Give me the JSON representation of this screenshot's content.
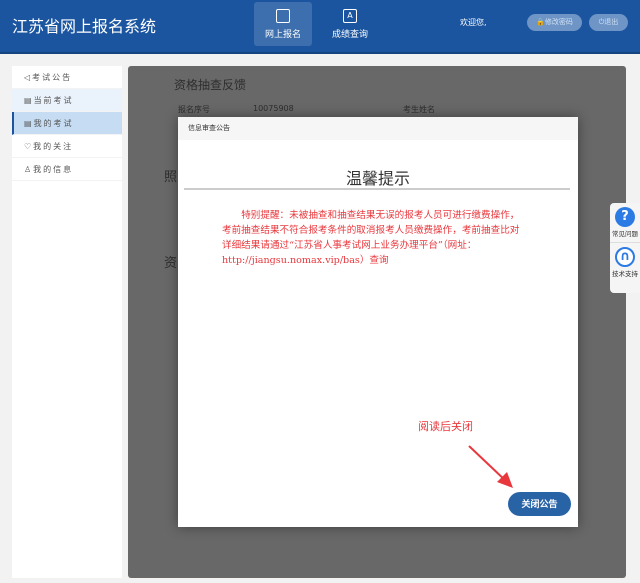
{
  "header": {
    "title": "江苏省网上报名系统",
    "nav": [
      {
        "label": "网上报名",
        "icon": "monitor-icon",
        "active": true
      },
      {
        "label": "成绩查询",
        "icon": "document-grade-icon"
      }
    ],
    "welcome": "欢迎您,",
    "change_password": "修改密码",
    "logout": "退出"
  },
  "sidebar": {
    "items": [
      {
        "label": "考试公告",
        "icon": "speaker-icon"
      },
      {
        "label": "当前考试",
        "icon": "edit-icon"
      },
      {
        "label": "我的考试",
        "icon": "list-icon",
        "selected": true
      },
      {
        "label": "我的关注",
        "icon": "heart-icon"
      },
      {
        "label": "我的信息",
        "icon": "user-icon"
      }
    ]
  },
  "background": {
    "section1": "资格抽查反馈",
    "field1_label": "报名序号",
    "field1_value": "10075908",
    "field2_label": "考生姓名",
    "section2": "照",
    "section3": "资"
  },
  "modal": {
    "header": "信息审查公告",
    "title": "温馨提示",
    "body": "特别提醒：未被抽查和抽查结果无误的报考人员可进行缴费操作，考前抽查结果不符合报考条件的取消报考人员缴费操作，考前抽查比对详细结果请通过“江苏省人事考试网上业务办理平台”（网址：http://jiangsu.nomax.vip/bas）查询",
    "close_button": "关闭公告"
  },
  "annotation": {
    "text": "阅读后关闭",
    "color": "#e8383d"
  },
  "float_panel": {
    "faq": "常见问题",
    "support": "技术支持"
  },
  "colors": {
    "header": "#1b55a0",
    "button": "#2863a6",
    "notice_text": "#e8383d"
  }
}
